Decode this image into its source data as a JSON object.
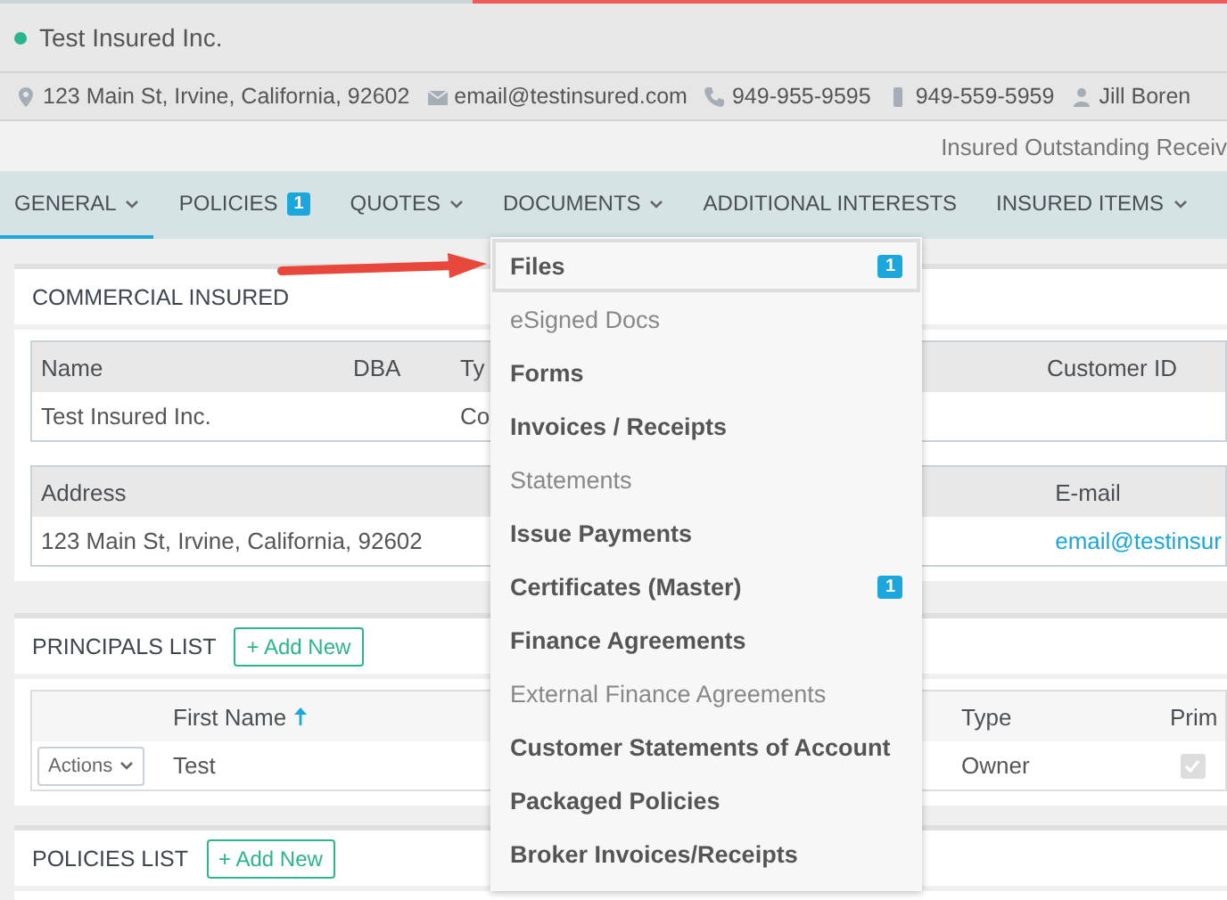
{
  "header": {
    "title": "Test Insured Inc."
  },
  "contact": [
    {
      "kind": "address",
      "text": "123 Main St, Irvine, California, 92602"
    },
    {
      "kind": "email",
      "text": "email@testinsured.com"
    },
    {
      "kind": "phone",
      "text": "949-955-9595"
    },
    {
      "kind": "mobile",
      "text": "949-559-5959"
    },
    {
      "kind": "person",
      "text": "Jill Boren"
    }
  ],
  "summary_link": "Insured Outstanding Receiv",
  "tabs": [
    {
      "label": "GENERAL",
      "selected": true,
      "dropdown": true
    },
    {
      "label": "POLICIES",
      "selected": false,
      "dropdown": false,
      "badge": "1"
    },
    {
      "label": "QUOTES",
      "selected": false,
      "dropdown": true
    },
    {
      "label": "DOCUMENTS",
      "selected": false,
      "dropdown": true
    },
    {
      "label": "ADDITIONAL INTERESTS",
      "selected": false,
      "dropdown": false
    },
    {
      "label": "INSURED ITEMS",
      "selected": false,
      "dropdown": true
    }
  ],
  "documents_menu": {
    "items": [
      {
        "label": "Files",
        "selected": true,
        "kind": "strong",
        "badge": "1"
      },
      {
        "label": "eSigned Docs",
        "selected": false,
        "kind": "light"
      },
      {
        "label": "Forms",
        "selected": false,
        "kind": "strong"
      },
      {
        "label": "Invoices / Receipts",
        "selected": false,
        "kind": "strong"
      },
      {
        "label": "Statements",
        "selected": false,
        "kind": "light"
      },
      {
        "label": "Issue Payments",
        "selected": false,
        "kind": "strong"
      },
      {
        "label": "Certificates (Master)",
        "selected": false,
        "kind": "strong",
        "badge": "1"
      },
      {
        "label": "Finance Agreements",
        "selected": false,
        "kind": "strong"
      },
      {
        "label": "External Finance Agreements",
        "selected": false,
        "kind": "light"
      },
      {
        "label": "Customer Statements of Account",
        "selected": false,
        "kind": "strong"
      },
      {
        "label": "Packaged Policies",
        "selected": false,
        "kind": "strong"
      },
      {
        "label": "Broker Invoices/Receipts",
        "selected": false,
        "kind": "strong"
      }
    ]
  },
  "commercial_insured": {
    "title": "COMMERCIAL INSURED",
    "tables": [
      {
        "columns": [
          "Name",
          "DBA",
          "Ty",
          "Customer ID"
        ],
        "rows": [
          [
            {
              "text": "Test Insured Inc."
            },
            {
              "text": ""
            },
            {
              "text": "Co"
            },
            {
              "text": ""
            }
          ]
        ]
      },
      {
        "columns": [
          "Address",
          "E-mail"
        ],
        "rows": [
          [
            {
              "text": "123 Main St, Irvine, California, 92602"
            },
            {
              "text": "email@testinsur",
              "kind": "link"
            }
          ]
        ]
      }
    ]
  },
  "principals_list": {
    "title": "PRINCIPALS LIST",
    "add_button": "+ Add New",
    "columns": [
      {
        "label": "First Name",
        "sorted_ascending": true
      },
      {
        "label": "Type"
      },
      {
        "label": "Prim"
      }
    ],
    "rows": [
      {
        "action": "Actions",
        "first_name": "Test",
        "type": "Owner",
        "primary_checked": true
      }
    ]
  },
  "policies_list": {
    "title": "POLICIES LIST",
    "add_button": "+ Add New"
  }
}
